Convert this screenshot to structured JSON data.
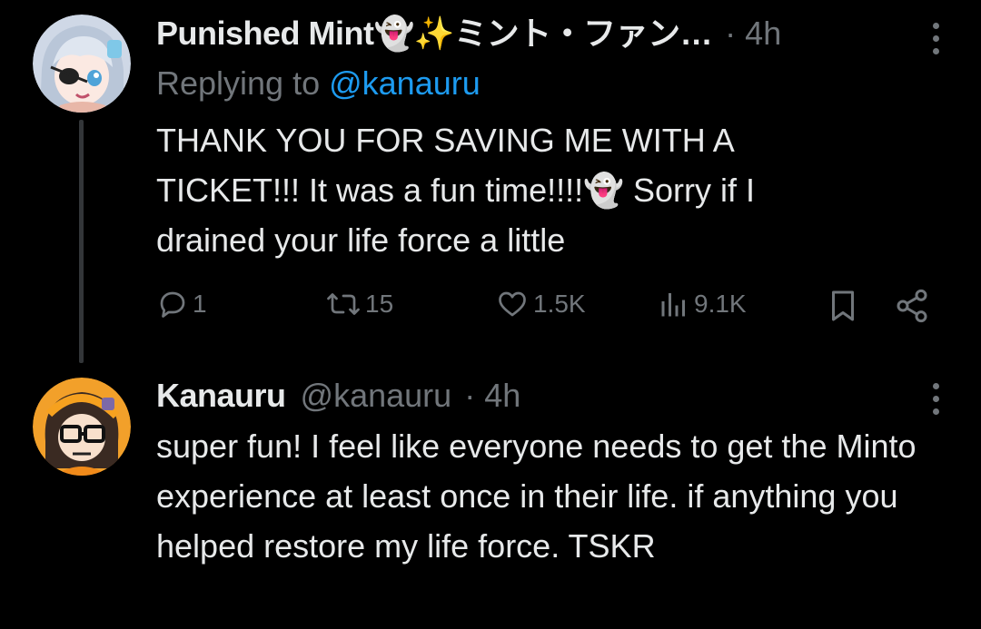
{
  "tweets": [
    {
      "display_name": "Punished Mint👻✨ミント・ファン…",
      "separator": "·",
      "time": "4h",
      "replying_prefix": "Replying to ",
      "replying_handle": "@kanauru",
      "text": "THANK YOU FOR SAVING ME WITH A TICKET!!! It was a fun time!!!!👻 Sorry if I drained your life force a little",
      "metrics": {
        "replies": "1",
        "retweets": "15",
        "likes": "1.5K",
        "views": "9.1K"
      }
    },
    {
      "display_name": "Kanauru",
      "handle": "@kanauru",
      "separator": "·",
      "time": "4h",
      "text": "super fun! I feel like everyone needs to get the Minto experience at least once in their life. if anything you helped restore my life force. TSKR"
    }
  ],
  "colors": {
    "background": "#000000",
    "text": "#e7e9ea",
    "muted": "#71767b",
    "link": "#1d9bf0",
    "thread_line": "#333639"
  },
  "icons": [
    "reply-icon",
    "retweet-icon",
    "like-icon",
    "views-icon",
    "bookmark-icon",
    "share-icon",
    "more-options-icon"
  ]
}
